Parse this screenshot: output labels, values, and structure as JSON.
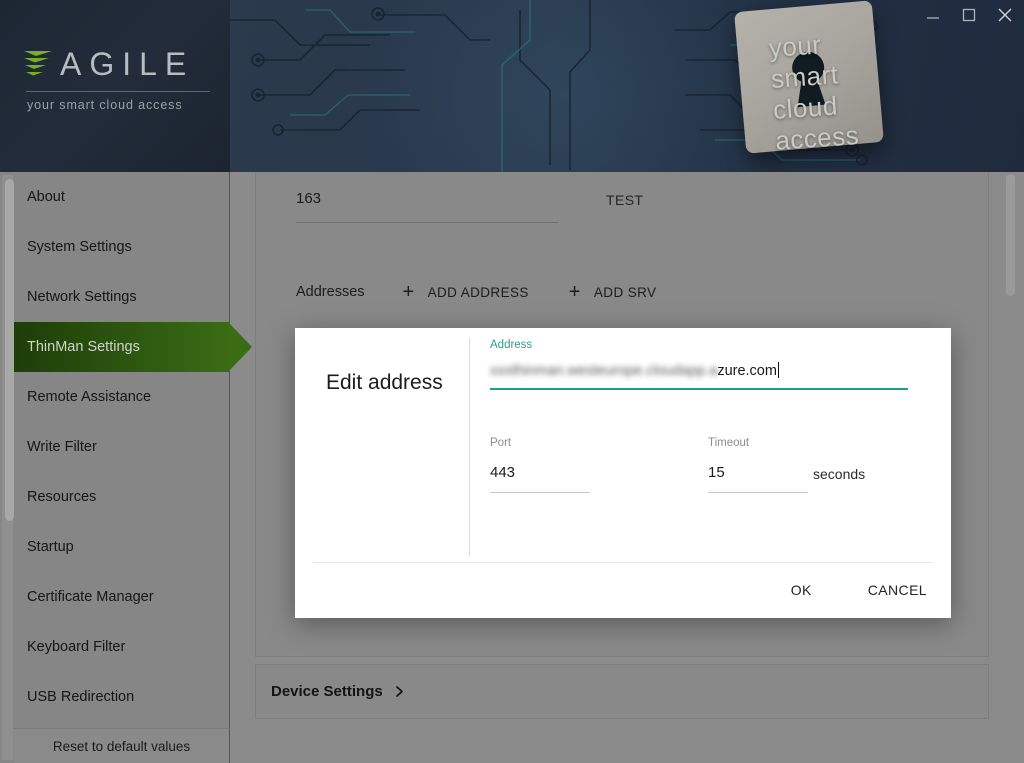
{
  "window": {
    "controls": [
      {
        "name": "minimize",
        "glyph": "minimize-icon"
      },
      {
        "name": "maximize",
        "glyph": "maximize-icon"
      },
      {
        "name": "close",
        "glyph": "close-icon"
      }
    ]
  },
  "brand": {
    "name": "AGILE",
    "tagline": "your smart cloud access",
    "banner_lines": [
      "your",
      "smart",
      "cloud",
      "access"
    ],
    "accent_green": "#7bb02a",
    "banner_bg": "#25303f"
  },
  "sidebar": {
    "items": [
      {
        "label": "About",
        "active": false
      },
      {
        "label": "System Settings",
        "active": false
      },
      {
        "label": "Network Settings",
        "active": false
      },
      {
        "label": "ThinMan Settings",
        "active": true
      },
      {
        "label": "Remote Assistance",
        "active": false
      },
      {
        "label": "Write Filter",
        "active": false
      },
      {
        "label": "Resources",
        "active": false
      },
      {
        "label": "Startup",
        "active": false
      },
      {
        "label": "Certificate Manager",
        "active": false
      },
      {
        "label": "Keyboard Filter",
        "active": false
      },
      {
        "label": "USB Redirection",
        "active": false
      }
    ],
    "footer_label": "Reset to default values",
    "active_color": "#2d5710"
  },
  "main": {
    "port_value": "163",
    "test_button": "TEST",
    "addresses_label": "Addresses",
    "add_address_button": "ADD ADDRESS",
    "add_srv_button": "ADD SRV",
    "plus_glyph": "+",
    "device_settings_label": "Device Settings"
  },
  "modal": {
    "title": "Edit address",
    "address_label": "Address",
    "address_value_redacted": "xxxthinman.westeurope.cloudapp.a",
    "address_value_visible": "zure.com",
    "address_accent": "#1a9e8f",
    "port_label": "Port",
    "port_value": "443",
    "timeout_label": "Timeout",
    "timeout_value": "15",
    "timeout_unit": "seconds",
    "ok_button": "OK",
    "cancel_button": "CANCEL"
  }
}
